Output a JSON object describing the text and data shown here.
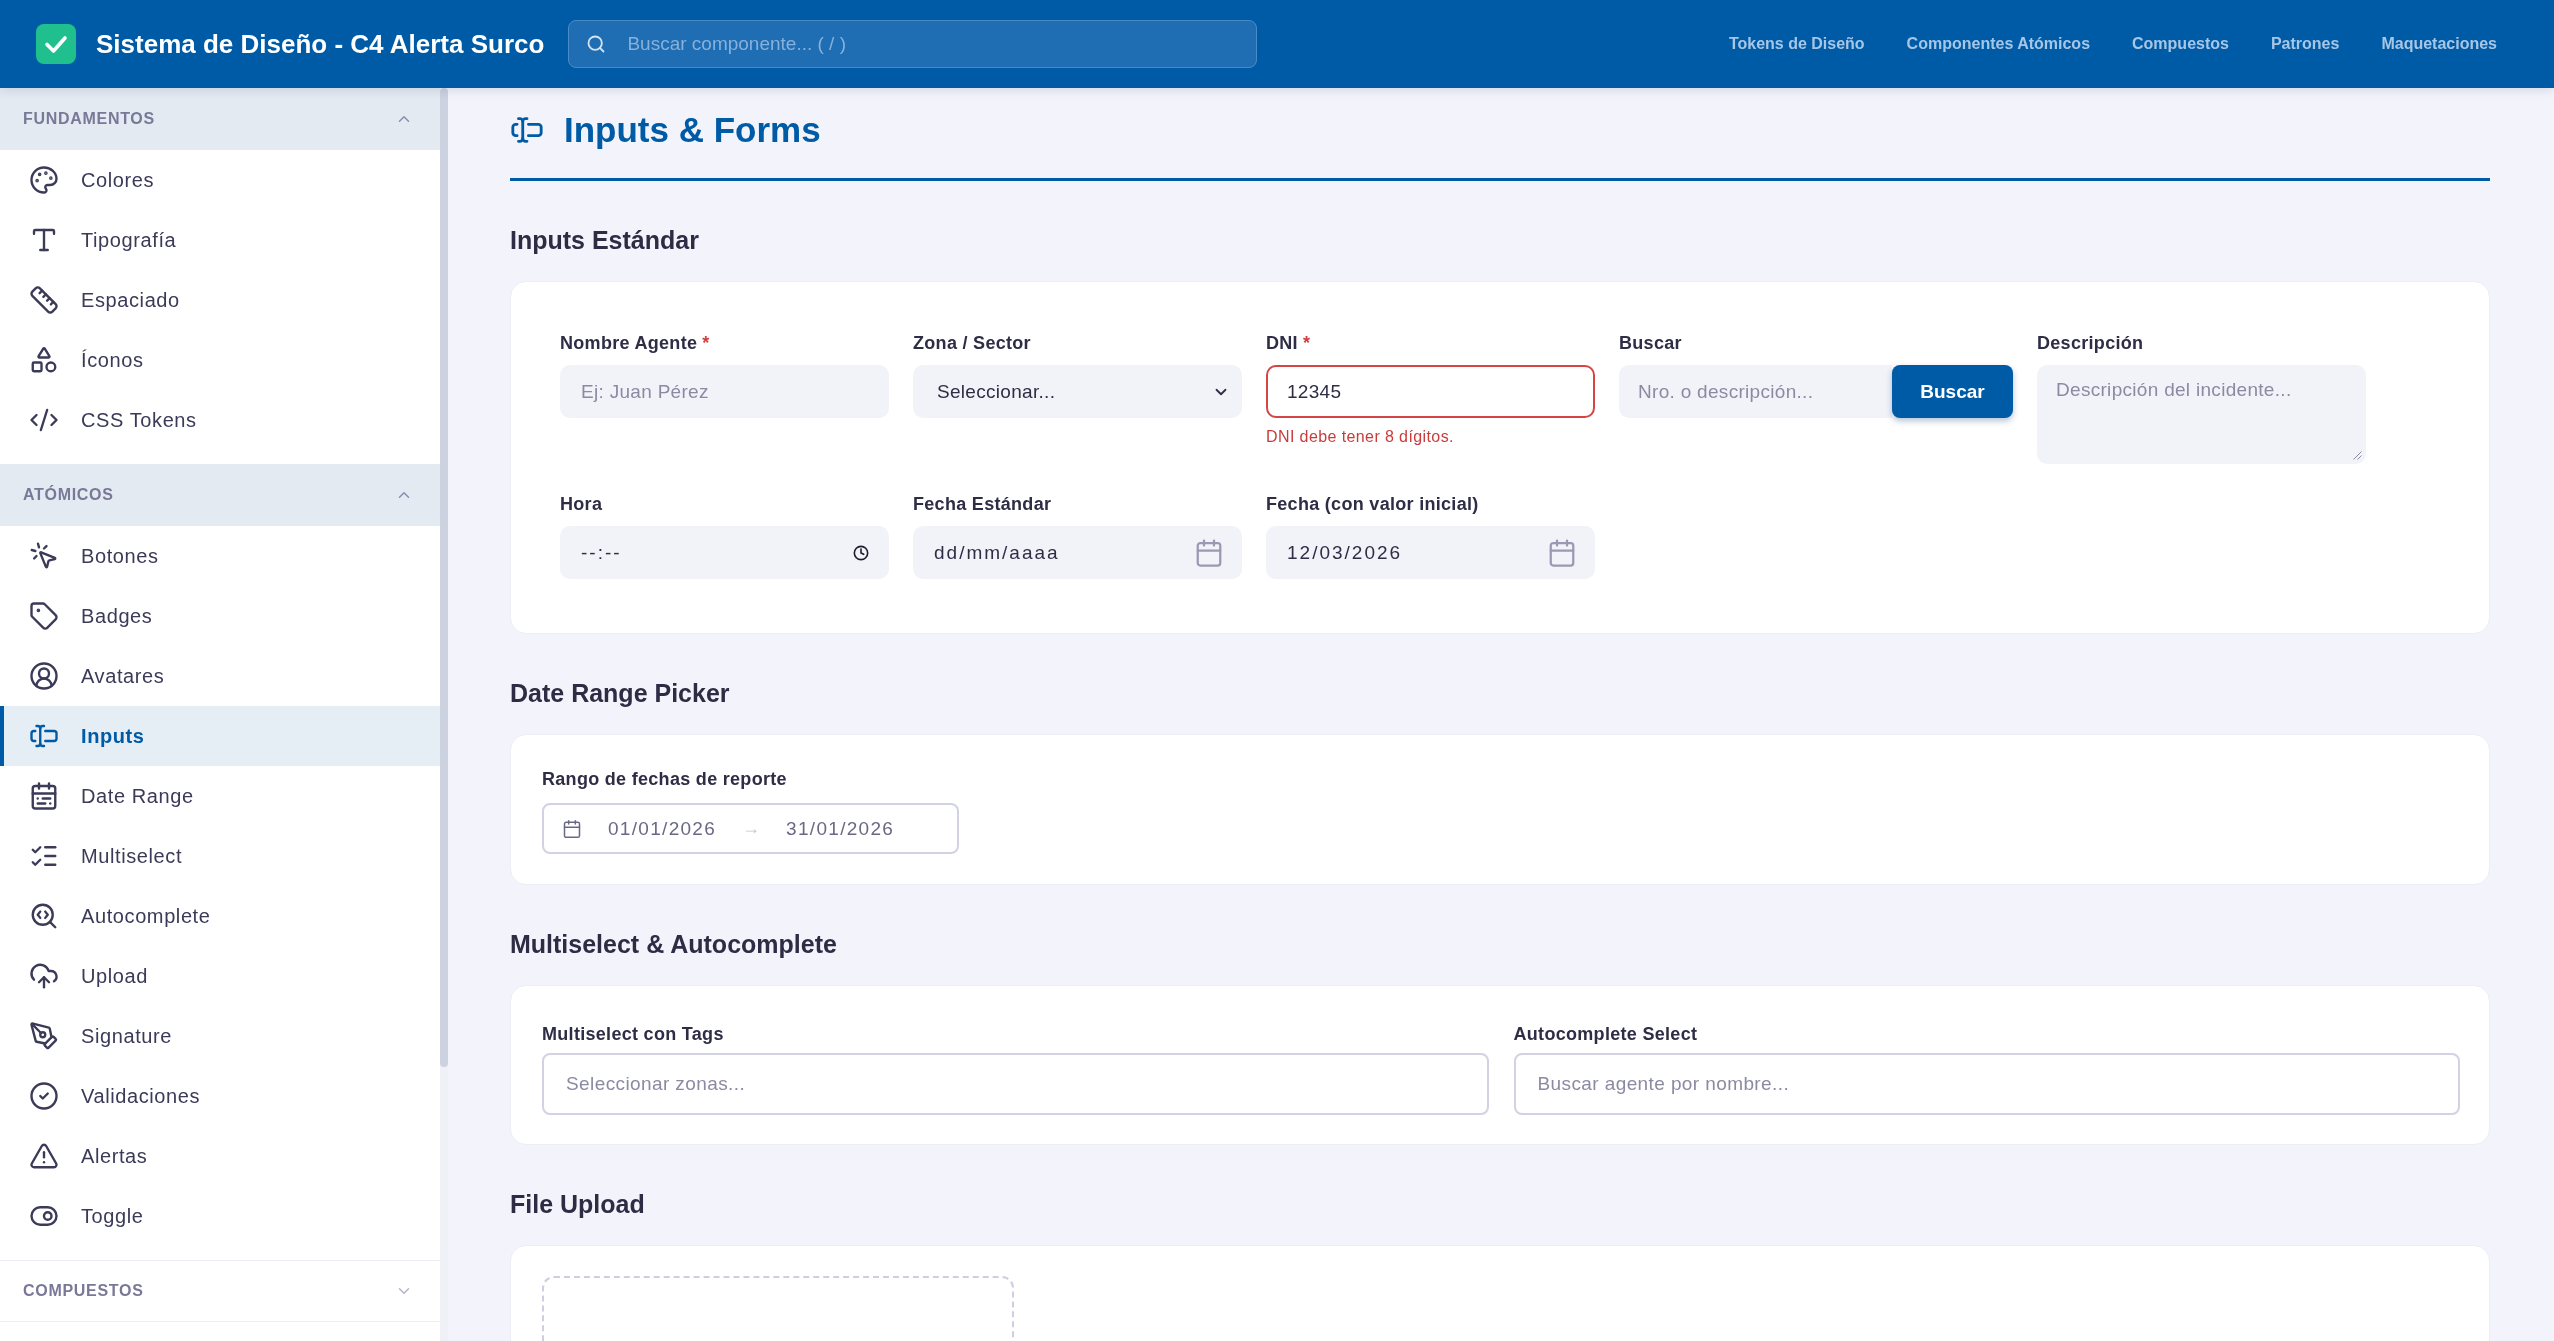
{
  "header": {
    "title": "Sistema de Diseño - C4 Alerta Surco",
    "search": {
      "placeholder": "Buscar componente... ( / )"
    },
    "nav": [
      {
        "label": "Tokens de Diseño"
      },
      {
        "label": "Componentes Atómicos"
      },
      {
        "label": "Compuestos"
      },
      {
        "label": "Patrones"
      },
      {
        "label": "Maquetaciones"
      }
    ]
  },
  "sidebar": {
    "sections": [
      {
        "title": "FUNDAMENTOS",
        "expanded": true,
        "items": [
          {
            "label": "Colores",
            "selected": false
          },
          {
            "label": "Tipografía",
            "selected": false
          },
          {
            "label": "Espaciado",
            "selected": false
          },
          {
            "label": "Íconos",
            "selected": false
          },
          {
            "label": "CSS Tokens",
            "selected": false
          }
        ]
      },
      {
        "title": "ATÓMICOS",
        "expanded": true,
        "items": [
          {
            "label": "Botones",
            "selected": false
          },
          {
            "label": "Badges",
            "selected": false
          },
          {
            "label": "Avatares",
            "selected": false
          },
          {
            "label": "Inputs",
            "selected": true
          },
          {
            "label": "Date Range",
            "selected": false
          },
          {
            "label": "Multiselect",
            "selected": false
          },
          {
            "label": "Autocomplete",
            "selected": false
          },
          {
            "label": "Upload",
            "selected": false
          },
          {
            "label": "Signature",
            "selected": false
          },
          {
            "label": "Validaciones",
            "selected": false
          },
          {
            "label": "Alertas",
            "selected": false
          },
          {
            "label": "Toggle",
            "selected": false
          }
        ]
      },
      {
        "title": "COMPUESTOS",
        "expanded": false
      }
    ]
  },
  "page": {
    "title": "Inputs & Forms",
    "sections": [
      {
        "kind": "fields",
        "title": "Inputs Estándar",
        "fields": [
          {
            "kind": "text",
            "label": "Nombre Agente",
            "required_mark": "*",
            "placeholder": "Ej: Juan Pérez"
          },
          {
            "kind": "select",
            "label": "Zona / Sector",
            "value": "Seleccionar..."
          },
          {
            "kind": "text",
            "label": "DNI",
            "required_mark": "*",
            "value": "12345",
            "error": "DNI debe tener 8 dígitos."
          },
          {
            "kind": "search",
            "label": "Buscar",
            "placeholder": "Nro. o descripción...",
            "button": "Buscar"
          },
          {
            "kind": "textarea",
            "label": "Descripción",
            "placeholder": "Descripción del incidente..."
          },
          {
            "kind": "time",
            "label": "Hora",
            "value": "--:--"
          },
          {
            "kind": "date",
            "label": "Fecha Estándar",
            "value": "dd/mm/aaaa"
          },
          {
            "kind": "date",
            "label": "Fecha (con valor inicial)",
            "value": "12/03/2026"
          }
        ]
      },
      {
        "kind": "date_range",
        "title": "Date Range Picker",
        "label": "Rango de fechas de reporte",
        "start": "01/01/2026",
        "separator": "→",
        "end": "31/01/2026"
      },
      {
        "kind": "pair",
        "title": "Multiselect & Autocomplete",
        "fields": [
          {
            "label": "Multiselect con Tags",
            "placeholder": "Seleccionar zonas..."
          },
          {
            "label": "Autocomplete Select",
            "placeholder": "Buscar agente por nombre..."
          }
        ]
      },
      {
        "kind": "upload",
        "title": "File Upload"
      }
    ]
  }
}
